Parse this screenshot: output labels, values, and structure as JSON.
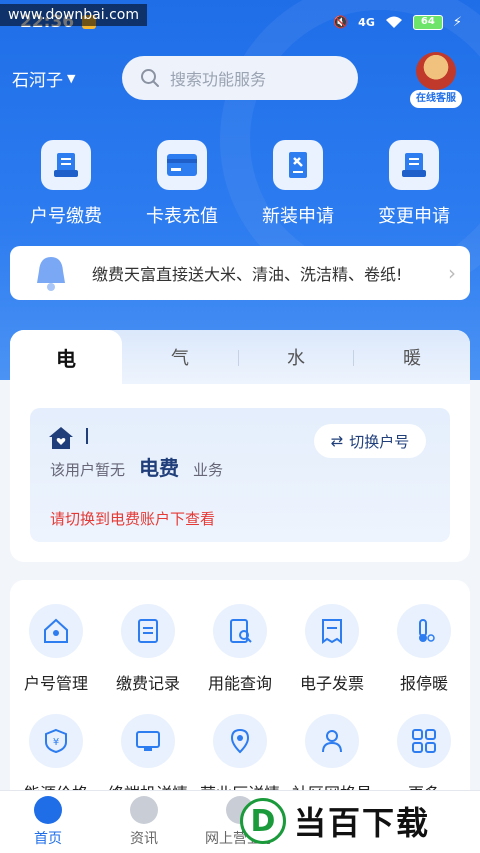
{
  "watermark": "www.downbai.com",
  "status": {
    "time": "22:36",
    "network": "4G",
    "battery": "64"
  },
  "header": {
    "city": "石河子",
    "search_placeholder": "搜索功能服务",
    "service_label": "在线客服"
  },
  "quick_actions": [
    {
      "label": "户号缴费",
      "icon": "bill-icon"
    },
    {
      "label": "卡表充值",
      "icon": "card-icon"
    },
    {
      "label": "新装申请",
      "icon": "tools-icon"
    },
    {
      "label": "变更申请",
      "icon": "change-icon"
    }
  ],
  "notice": {
    "text": "缴费天富直接送大米、清油、洗洁精、卷纸!"
  },
  "tabs": [
    {
      "label": "电"
    },
    {
      "label": "气"
    },
    {
      "label": "水"
    },
    {
      "label": "暖"
    }
  ],
  "account": {
    "prefix": "该用户暂无",
    "fee": "电费",
    "suffix": "业务",
    "switch_label": "切换户号",
    "warning": "请切换到电费账户下查看"
  },
  "services": [
    {
      "label": "户号管理",
      "icon": "house-icon"
    },
    {
      "label": "缴费记录",
      "icon": "record-icon"
    },
    {
      "label": "用能查询",
      "icon": "query-icon"
    },
    {
      "label": "电子发票",
      "icon": "invoice-icon"
    },
    {
      "label": "报停暖",
      "icon": "thermometer-icon"
    },
    {
      "label": "能源价格",
      "icon": "price-icon"
    },
    {
      "label": "终端机详情",
      "icon": "terminal-icon"
    },
    {
      "label": "营业厅详情",
      "icon": "location-icon"
    },
    {
      "label": "社区网格员",
      "icon": "person-icon"
    },
    {
      "label": "更多",
      "icon": "more-icon"
    }
  ],
  "nav": [
    {
      "label": "首页"
    },
    {
      "label": "资讯"
    },
    {
      "label": "网上营业厅"
    }
  ],
  "brand": {
    "badge": "D",
    "text": "当百下载"
  },
  "colors": {
    "primary": "#1f6ee8",
    "warning": "#e53935"
  }
}
